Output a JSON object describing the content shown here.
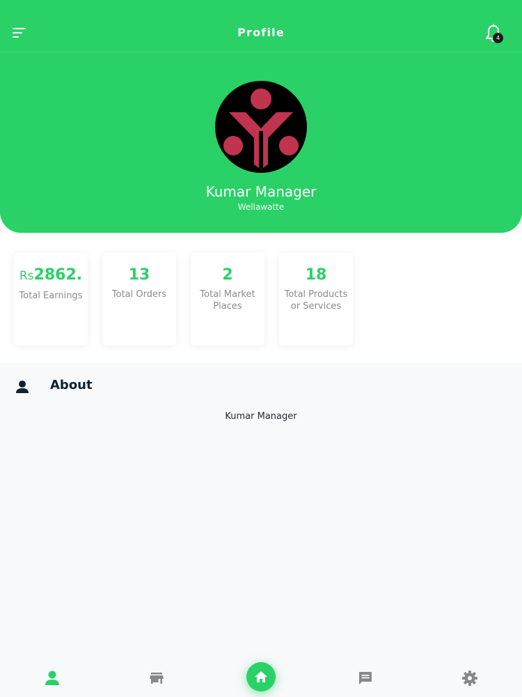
{
  "header": {
    "title": "Profile",
    "notification_count": "4"
  },
  "profile": {
    "name": "Kumar Manager",
    "location": "Wellawatte",
    "avatar_icon": "logo-icon"
  },
  "stats": [
    {
      "currency": "Rs",
      "value": "2862.",
      "label": "Total Earnings"
    },
    {
      "value": "13",
      "label": "Total Orders"
    },
    {
      "value": "2",
      "label": "Total Market Places"
    },
    {
      "value": "18",
      "label": "Total Products or Services"
    }
  ],
  "about": {
    "title": "About",
    "text": "Kumar Manager"
  },
  "nav": {
    "items": [
      "person-icon",
      "store-icon",
      "home-icon",
      "chat-icon",
      "gear-icon"
    ],
    "active": "person-icon"
  },
  "colors": {
    "accent": "#2ad167",
    "avatar_mark": "#c0344f",
    "dark_text": "#0f2233"
  }
}
